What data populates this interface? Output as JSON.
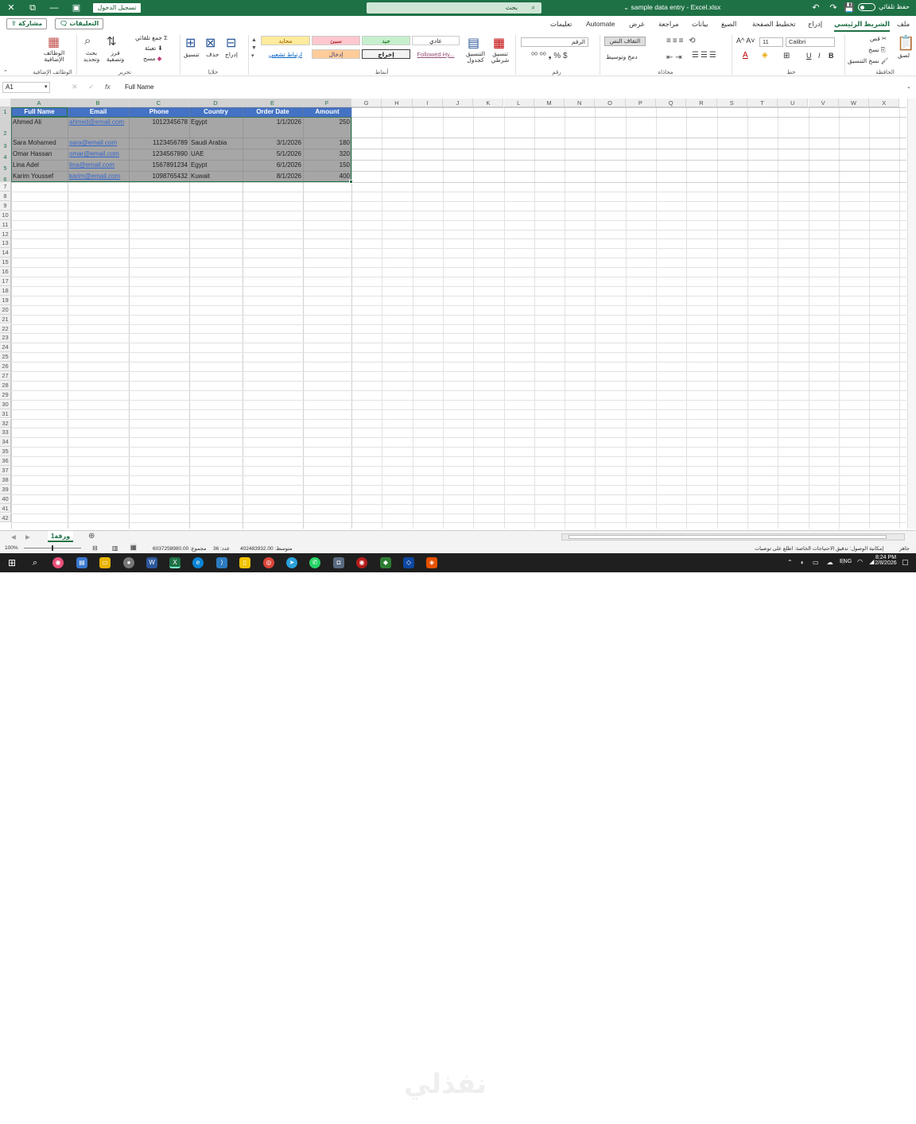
{
  "titlebar": {
    "autosave_label": "حفظ تلقائي",
    "doc_title": "sample data entry - Excel.xlsx",
    "search_placeholder": "بحث",
    "signin_label": "تسجيل الدخول"
  },
  "tabs": {
    "items": [
      {
        "label": "ملف"
      },
      {
        "label": "الشريط الرئيسي"
      },
      {
        "label": "إدراج"
      },
      {
        "label": "تخطيط الصفحة"
      },
      {
        "label": "الصيغ"
      },
      {
        "label": "بيانات"
      },
      {
        "label": "مراجعة"
      },
      {
        "label": "عرض"
      },
      {
        "label": "Automate"
      },
      {
        "label": "تعليمات"
      }
    ],
    "comments_label": "التعليقات",
    "share_label": "مشاركة"
  },
  "ribbon": {
    "clipboard": {
      "name": "الحافظة",
      "paste": "لصق",
      "cut": "قص",
      "copy": "نسخ",
      "format_painter": "نسخ التنسيق"
    },
    "font": {
      "name": "خط",
      "font_name": "Calibri",
      "font_size": "11"
    },
    "alignment": {
      "name": "محاذاة",
      "wrap": "التفاف النص",
      "merge": "دمج وتوسيط"
    },
    "number": {
      "name": "رقم",
      "format": "الرقم"
    },
    "styles": {
      "name": "أنماط",
      "conditional": "تنسيق شرطي",
      "as_table": "التنسيق كجدول",
      "cells": [
        "عادي",
        "جيد",
        "سيئ",
        "محايد",
        "إخراج",
        "إدخال",
        "Followed Hy...",
        "ارتباط تشعبي"
      ]
    },
    "cells": {
      "name": "خلايا",
      "insert": "إدراج",
      "delete": "حذف",
      "format": "تنسيق"
    },
    "editing": {
      "name": "تحرير",
      "autosum": "جمع تلقائي",
      "fill": "تعبئة",
      "clear": "مسح",
      "sort": "فرز وتصفية",
      "find": "بحث وتحديد"
    },
    "addins": {
      "name": "الوظائف الإضافية",
      "label": "الوظائف الإضافية"
    },
    "colors": {
      "good": "#c6efce",
      "bad": "#ffc7ce",
      "neutral": "#ffeb9c",
      "input": "#ffcc99",
      "hyperlink": "#0563c1",
      "followed": "#954f72"
    }
  },
  "formula_bar": {
    "cell_ref": "A1",
    "content": "Full Name"
  },
  "columns": [
    "A",
    "B",
    "C",
    "D",
    "E",
    "F",
    "G",
    "H",
    "I",
    "J",
    "K",
    "L",
    "M",
    "N",
    "O",
    "P",
    "Q",
    "R",
    "S",
    "T",
    "U",
    "V",
    "W",
    "X"
  ],
  "table": {
    "headers": [
      "Full Name",
      "Email",
      "Phone",
      "Country",
      "Order Date",
      "Amount"
    ],
    "rows": [
      [
        "Ahmed Ali",
        "ahmed@email.com",
        "1012345678",
        "Egypt",
        "1/1/2026",
        "250"
      ],
      [
        "Sara Mohamed",
        "sara@email.com",
        "1123456789",
        "Saudi Arabia",
        "3/1/2026",
        "180"
      ],
      [
        "Omar Hassan",
        "omar@email.com",
        "1234567890",
        "UAE",
        "5/1/2026",
        "320"
      ],
      [
        "Lina Adel",
        "lina@email.com",
        "1567891234",
        "Egypt",
        "6/1/2026",
        "150"
      ],
      [
        "Karim Youssef",
        "karim@email.com",
        "1098765432",
        "Kuwait",
        "8/1/2026",
        "400"
      ]
    ],
    "header_color": "#4472c4",
    "selection_color": "#a6a6a6"
  },
  "sheet": {
    "tab_name": "ورقة1"
  },
  "status": {
    "ready": "جاهز",
    "accessibility": "إمكانية الوصول: تدقيق الاحتياجات الخاصة: اطلع على توصيات",
    "average": "متوسط: 402483932.00",
    "count": "عدد: 36",
    "sum": "مجموع: 6037258980.00",
    "zoom": "100%"
  },
  "taskbar": {
    "time": "8:24 PM",
    "date": "2/8/2026",
    "lang": "ENG",
    "watermark": "nafezly.com",
    "watermark_ar": "نفذلي"
  }
}
